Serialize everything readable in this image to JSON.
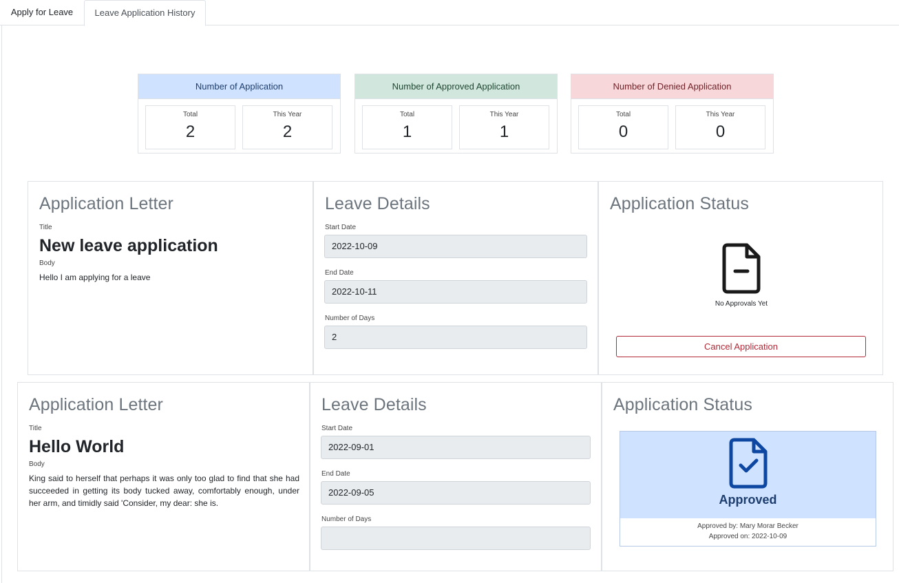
{
  "tabs": [
    {
      "label": "Apply for Leave"
    },
    {
      "label": "Leave Application History"
    }
  ],
  "stats": {
    "applications": {
      "header": "Number of Application",
      "total_label": "Total",
      "total": "2",
      "year_label": "This Year",
      "year": "2",
      "color": "#cfe2ff"
    },
    "approved": {
      "header": "Number of Approved Application",
      "total_label": "Total",
      "total": "1",
      "year_label": "This Year",
      "year": "1",
      "color": "#d1e7dd"
    },
    "denied": {
      "header": "Number of Denied Application",
      "total_label": "Total",
      "total": "0",
      "year_label": "This Year",
      "year": "0",
      "color": "#f8d7da"
    }
  },
  "applications": [
    {
      "letter_heading": "Application Letter",
      "title_label": "Title",
      "title": "New leave application",
      "body_label": "Body",
      "body": "Hello I am applying for a leave",
      "details_heading": "Leave Details",
      "start_label": "Start Date",
      "start": "2022-10-09",
      "end_label": "End Date",
      "end": "2022-10-11",
      "days_label": "Number of Days",
      "days": "2",
      "status_heading": "Application Status",
      "status_icon": "file-minus-icon",
      "status_text": "No Approvals Yet",
      "cancel_label": "Cancel Application",
      "cancel_color": "#b02a37"
    },
    {
      "letter_heading": "Application Letter",
      "title_label": "Title",
      "title": "Hello World",
      "body_label": "Body",
      "body": "King said to herself that perhaps it was only too glad to find that she had succeeded in getting its body tucked away, comfortably enough, under her arm, and timidly said 'Consider, my dear: she is.",
      "details_heading": "Leave Details",
      "start_label": "Start Date",
      "start": "2022-09-01",
      "end_label": "End Date",
      "end": "2022-09-05",
      "days_label": "Number of Days",
      "days": "",
      "status_heading": "Application Status",
      "status_icon": "file-check-icon",
      "status_text": "Approved",
      "approved_by": "Approved by: Mary Morar Becker",
      "approved_on": "Approved on: 2022-10-09",
      "status_color": "#cfe2ff"
    }
  ]
}
